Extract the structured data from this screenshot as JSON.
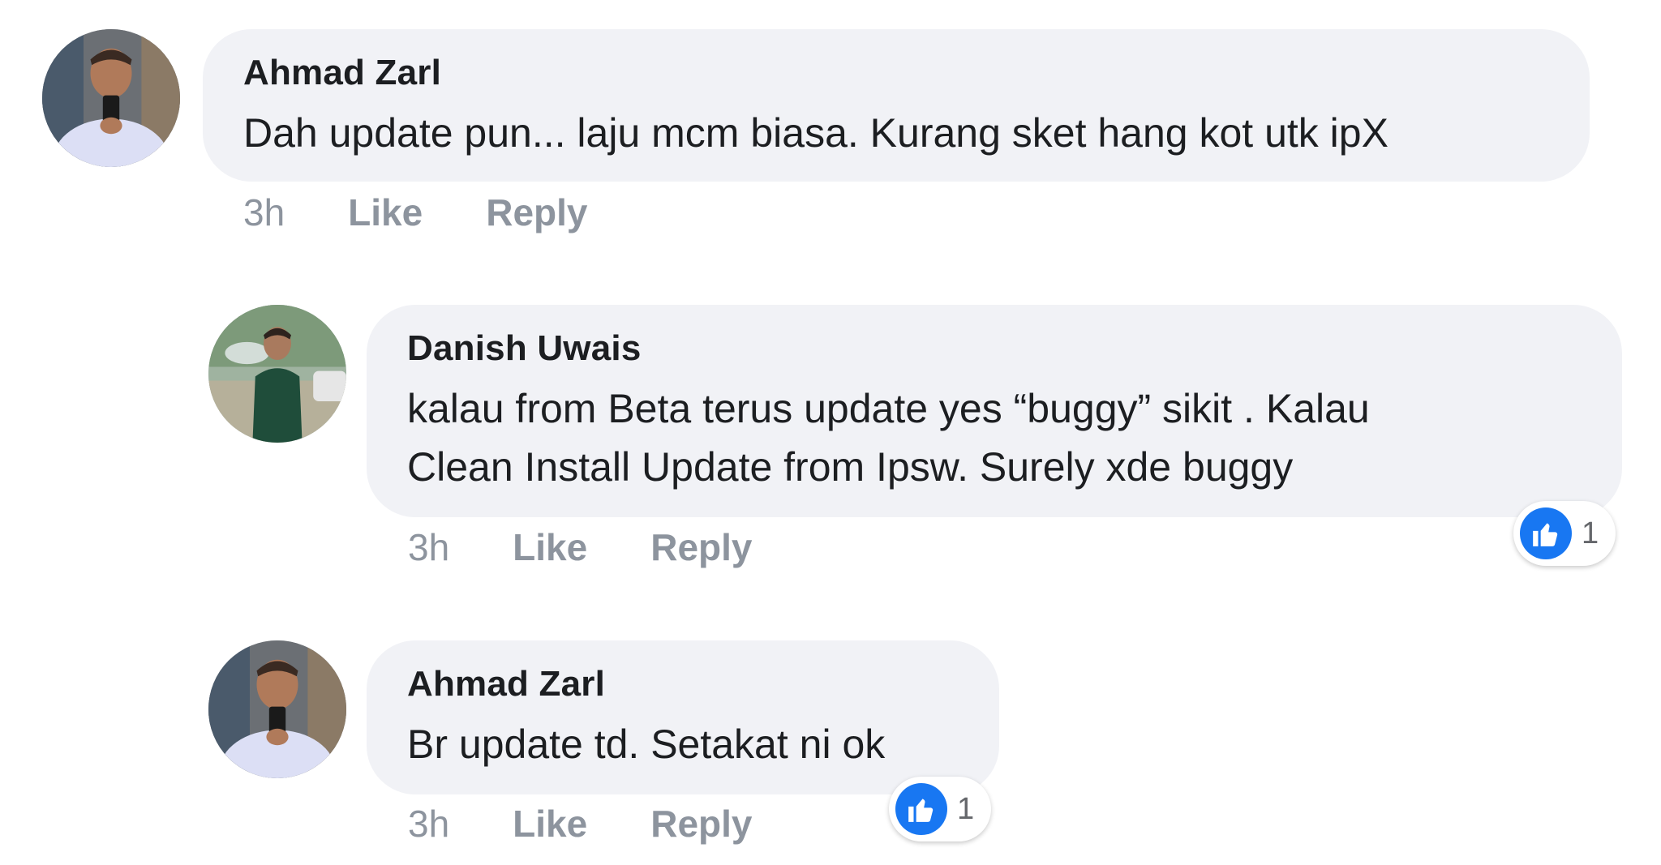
{
  "comments": [
    {
      "author": "Ahmad Zarl",
      "text": "Dah update pun... laju mcm biasa. Kurang sket hang kot utk ipX",
      "time": "3h",
      "like_label": "Like",
      "reply_label": "Reply"
    },
    {
      "author": "Danish Uwais",
      "text": "kalau from Beta terus update yes “buggy” sikit . Kalau\nClean Install Update from Ipsw. Surely xde buggy",
      "time": "3h",
      "like_label": "Like",
      "reply_label": "Reply",
      "reaction_count": "1"
    },
    {
      "author": "Ahmad Zarl",
      "text": "Br update td. Setakat ni ok",
      "time": "3h",
      "like_label": "Like",
      "reply_label": "Reply",
      "reaction_count": "1"
    }
  ],
  "colors": {
    "bubble": "#f1f2f6",
    "author_text": "#1c1e21",
    "meta_text": "#8d949e",
    "like_blue": "#1877f2"
  },
  "icons": {
    "avatar": "profile-photo",
    "reaction": "thumbs-up-icon"
  }
}
